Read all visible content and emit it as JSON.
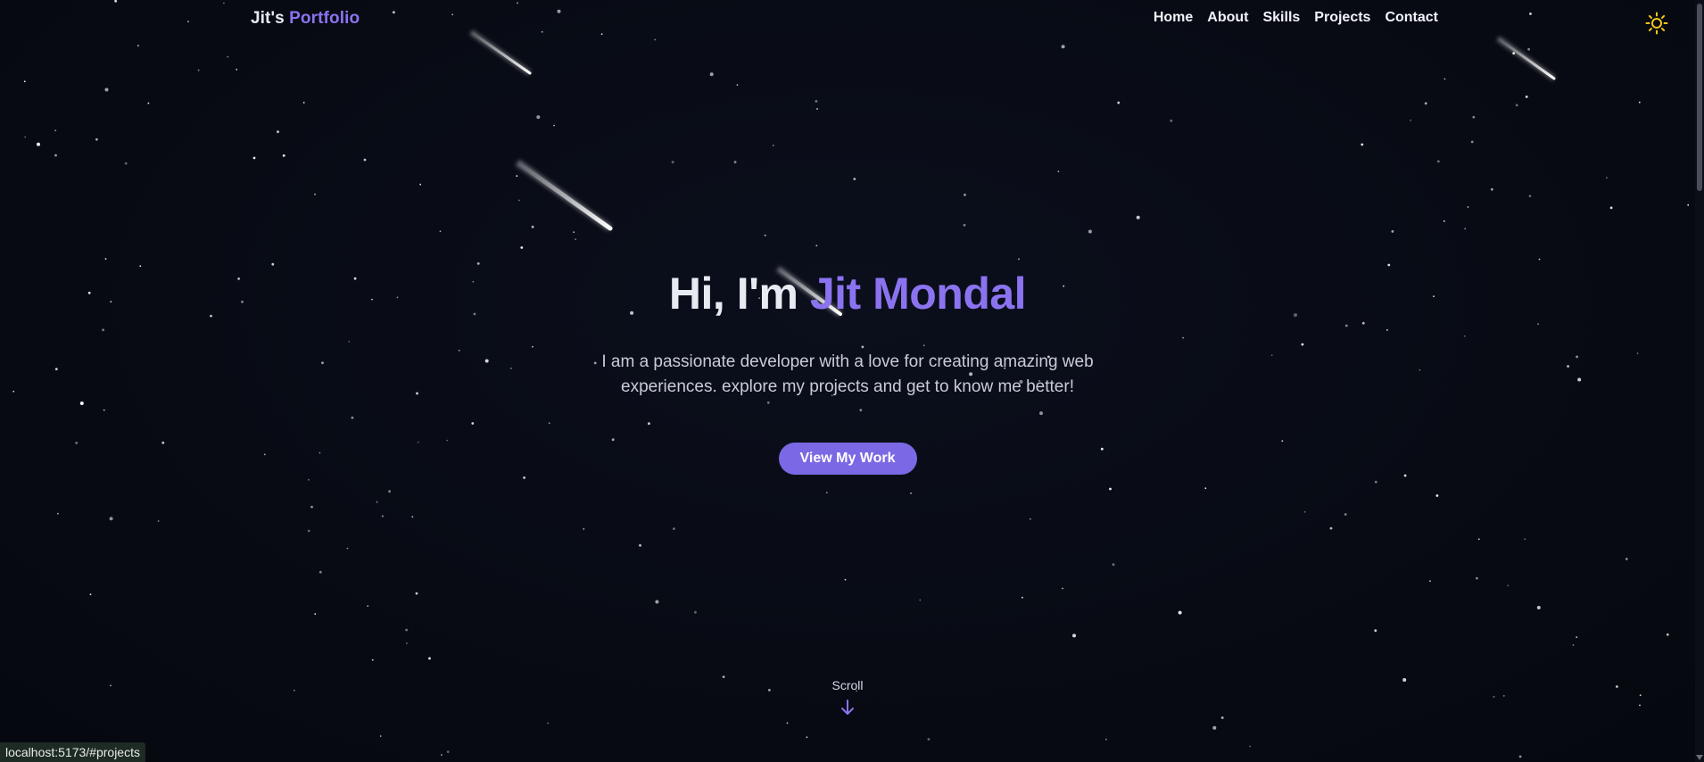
{
  "brand": {
    "prefix": "Jit's",
    "accent": "Portfolio"
  },
  "nav": {
    "items": [
      {
        "label": "Home",
        "name": "nav-home"
      },
      {
        "label": "About",
        "name": "nav-about"
      },
      {
        "label": "Skills",
        "name": "nav-skills"
      },
      {
        "label": "Projects",
        "name": "nav-projects"
      },
      {
        "label": "Contact",
        "name": "nav-contact"
      }
    ],
    "theme_toggle_icon": "sun-icon"
  },
  "hero": {
    "greeting": "Hi, I'm",
    "name": "Jit Mondal",
    "description": "I am a passionate developer with a love for creating amazing web experiences. explore my projects and get to know me better!",
    "cta_label": "View My Work"
  },
  "scroll": {
    "label": "Scroll",
    "icon": "arrow-down-icon"
  },
  "status_bar": {
    "url": "localhost:5173/#projects"
  },
  "colors": {
    "background": "#070a12",
    "accent": "#8b73f0",
    "button": "#7b68e4",
    "sun": "#f5c518",
    "text": "#e8eaf2"
  }
}
